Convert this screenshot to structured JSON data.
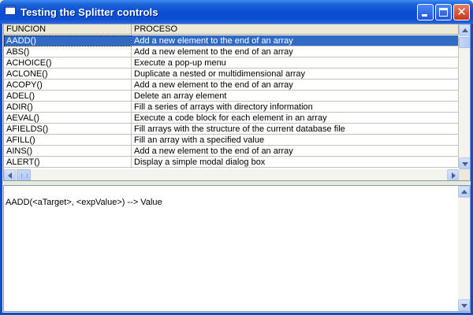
{
  "window": {
    "title": "Testing the Splitter controls"
  },
  "grid": {
    "columns": [
      "FUNCION",
      "PROCESO"
    ],
    "rows": [
      {
        "funcion": "AADD()",
        "proceso": "Add a new element to the end of an array"
      },
      {
        "funcion": "ABS()",
        "proceso": "Add a new element to the end of an array"
      },
      {
        "funcion": "ACHOICE()",
        "proceso": "Execute a pop-up menu"
      },
      {
        "funcion": "ACLONE()",
        "proceso": "Duplicate a nested or multidimensional array"
      },
      {
        "funcion": "ACOPY()",
        "proceso": "Add a new element to the end of an array"
      },
      {
        "funcion": "ADEL()",
        "proceso": "Delete an array element"
      },
      {
        "funcion": "ADIR()",
        "proceso": "Fill a series of arrays with directory information"
      },
      {
        "funcion": "AEVAL()",
        "proceso": "Execute a code block for each element in an array"
      },
      {
        "funcion": "AFIELDS()",
        "proceso": "Fill arrays with the structure of the current database file"
      },
      {
        "funcion": "AFILL()",
        "proceso": "Fill an array with a specified value"
      },
      {
        "funcion": "AINS()",
        "proceso": "Add a new element to the end of an array"
      },
      {
        "funcion": "ALERT()",
        "proceso": "Display a simple modal dialog box"
      }
    ],
    "selected_index": 0
  },
  "memo": {
    "text": "AADD(<aTarget>, <expValue>) --> Value"
  },
  "colors": {
    "selection": "#316ac5",
    "titlebar": "#0a4ed2"
  },
  "icons": [
    "app-icon",
    "minimize-icon",
    "maximize-icon",
    "close-icon",
    "scroll-up-arrow-icon",
    "scroll-down-arrow-icon",
    "scroll-left-arrow-icon",
    "scroll-right-arrow-icon"
  ]
}
